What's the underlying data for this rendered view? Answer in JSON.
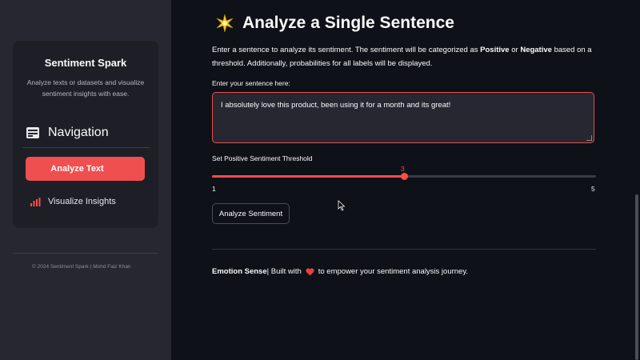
{
  "sidebar": {
    "title": "Sentiment Spark",
    "description": "Analyze texts or datasets and visualize sentiment insights with ease.",
    "nav_heading": "Navigation",
    "items": [
      {
        "label": "Analyze Text",
        "active": true
      },
      {
        "label": "Visualize Insights",
        "icon": "bar-chart-icon",
        "active": false
      }
    ],
    "footer": "© 2024 Sentiment Spark | Mohd Faiz Khan"
  },
  "main": {
    "title": "Analyze a Single Sentence",
    "title_icon": "sparkle-icon",
    "description": {
      "part1": "Enter a sentence to analyze its sentiment. The sentiment will be categorized as ",
      "positive": "Positive",
      "part2": " or ",
      "negative": "Negative",
      "part3": " based on a threshold. Additionally, probabilities for all labels will be displayed."
    },
    "input_label": "Enter your sentence here:",
    "input_value": "I absolutely love this product, been using it for a month and its great!",
    "slider": {
      "label": "Set Positive Sentiment Threshold",
      "value": 3,
      "min": 1,
      "max": 5
    },
    "analyze_button": "Analyze Sentiment",
    "footer": {
      "brand": "Emotion Sense",
      "built_with": " | Built with",
      "rest": "to empower your sentiment analysis journey."
    }
  },
  "colors": {
    "accent": "#ff4b4b",
    "background": "#0e1117",
    "sidebar": "#262730"
  }
}
